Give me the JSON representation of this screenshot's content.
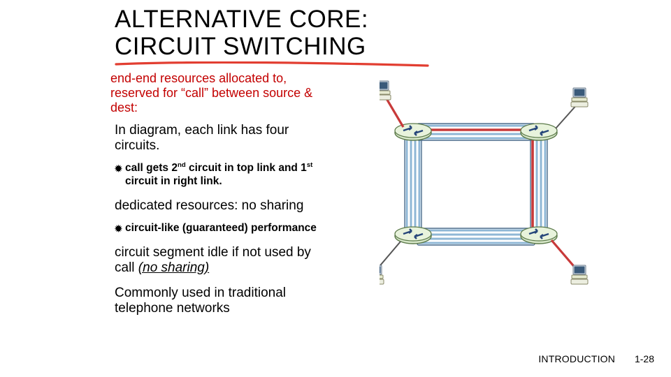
{
  "title_line1": "ALTERNATIVE CORE:",
  "title_line2": "CIRCUIT SWITCHING",
  "lead": "end-end resources allocated to, reserved for “call” between source & dest:",
  "points": {
    "p1": "In diagram, each link has four circuits.",
    "s1a": "call gets 2",
    "s1b": " circuit in top link and 1",
    "s1c": " circuit in right link.",
    "sup_nd": "nd",
    "sup_st": "st",
    "p2": "dedicated resources: no sharing",
    "s2": "circuit-like (guaranteed) performance",
    "p3_pre": "circuit segment idle if not used by call ",
    "p3_ital": "(no sharing)",
    "p4": "Commonly used in traditional telephone networks"
  },
  "footer": {
    "label": "INTRODUCTION",
    "page": "1-28"
  },
  "colors": {
    "underline": "#e23e31",
    "lead": "#c30000"
  }
}
